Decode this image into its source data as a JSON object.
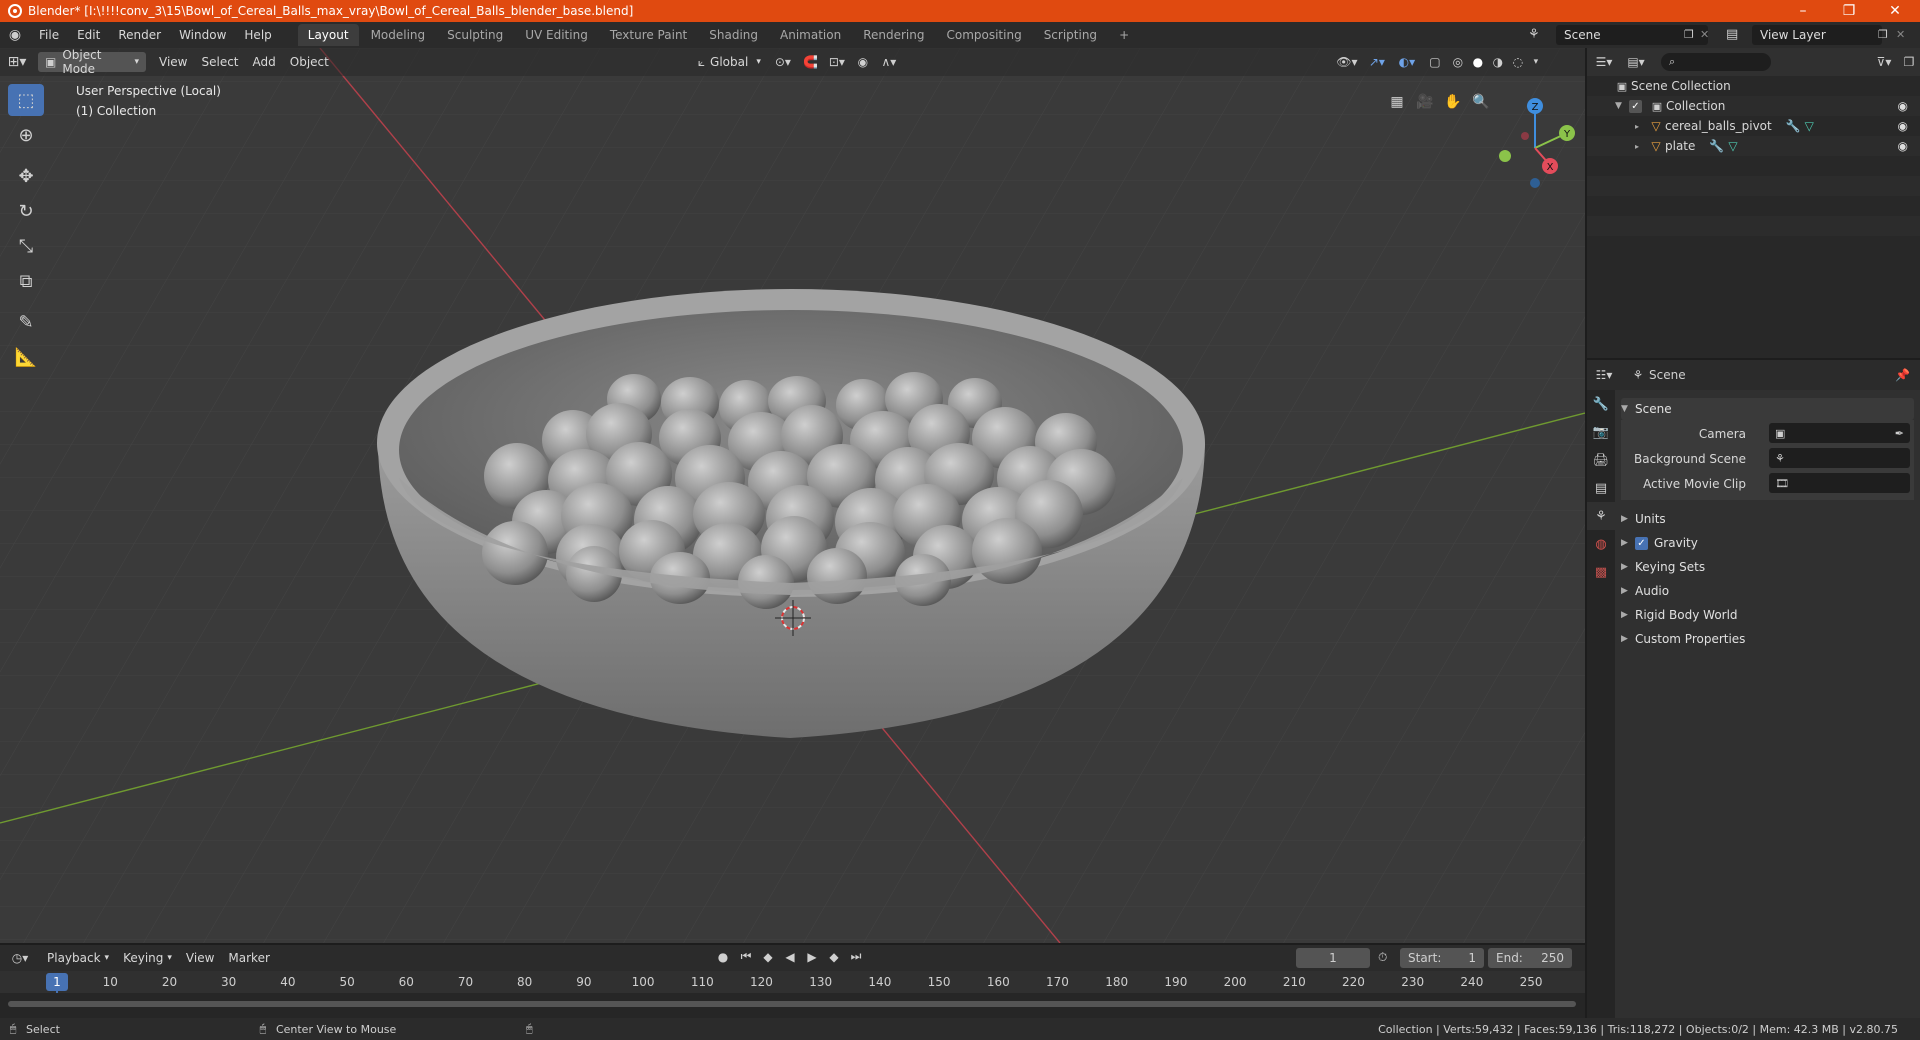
{
  "window": {
    "title": "Blender* [I:\\!!!!conv_3\\15\\Bowl_of_Cereal_Balls_max_vray\\Bowl_of_Cereal_Balls_blender_base.blend]",
    "minimize": "–",
    "maximize": "❐",
    "close": "✕"
  },
  "menu": [
    "File",
    "Edit",
    "Render",
    "Window",
    "Help"
  ],
  "workspaces": [
    "Layout",
    "Modeling",
    "Sculpting",
    "UV Editing",
    "Texture Paint",
    "Shading",
    "Animation",
    "Rendering",
    "Compositing",
    "Scripting"
  ],
  "workspace_add": "+",
  "scene_field": "Scene",
  "view_layer_field": "View Layer",
  "viewport": {
    "mode": "Object Mode",
    "menus": [
      "View",
      "Select",
      "Add",
      "Object"
    ],
    "transform_orientation": "Global",
    "perspective_label": "User Perspective (Local)",
    "collection_label": "(1) Collection",
    "gizmo_axes": {
      "z": "Z",
      "y": "Y",
      "x": "X"
    }
  },
  "outliner": {
    "root": "Scene Collection",
    "collection": "Collection",
    "objects": [
      "cereal_balls_pivot",
      "plate"
    ]
  },
  "properties": {
    "context": "Scene",
    "panel_scene": "Scene",
    "camera_label": "Camera",
    "background_scene_label": "Background Scene",
    "active_movie_clip_label": "Active Movie Clip",
    "panels": [
      "Units",
      "Gravity",
      "Keying Sets",
      "Audio",
      "Rigid Body World",
      "Custom Properties"
    ]
  },
  "timeline": {
    "menus": [
      "Playback",
      "Keying",
      "View",
      "Marker"
    ],
    "current_frame": "1",
    "start_label": "Start:",
    "start_value": "1",
    "end_label": "End:",
    "end_value": "250",
    "ticks": [
      "1",
      "10",
      "20",
      "30",
      "40",
      "50",
      "60",
      "70",
      "80",
      "90",
      "100",
      "110",
      "120",
      "130",
      "140",
      "150",
      "160",
      "170",
      "180",
      "190",
      "200",
      "210",
      "220",
      "230",
      "240",
      "250"
    ]
  },
  "statusbar": {
    "left_action": "Select",
    "middle_action": "Center View to Mouse",
    "stats": "Collection | Verts:59,432 | Faces:59,136 | Tris:118,272 | Objects:0/2 | Mem: 42.3 MB | v2.80.75"
  },
  "colors": {
    "title_bar": "#e04a10",
    "accent": "#4772b3",
    "x_axis": "#e34c5b",
    "y_axis": "#8bc34a",
    "z_axis": "#3f8ede"
  }
}
